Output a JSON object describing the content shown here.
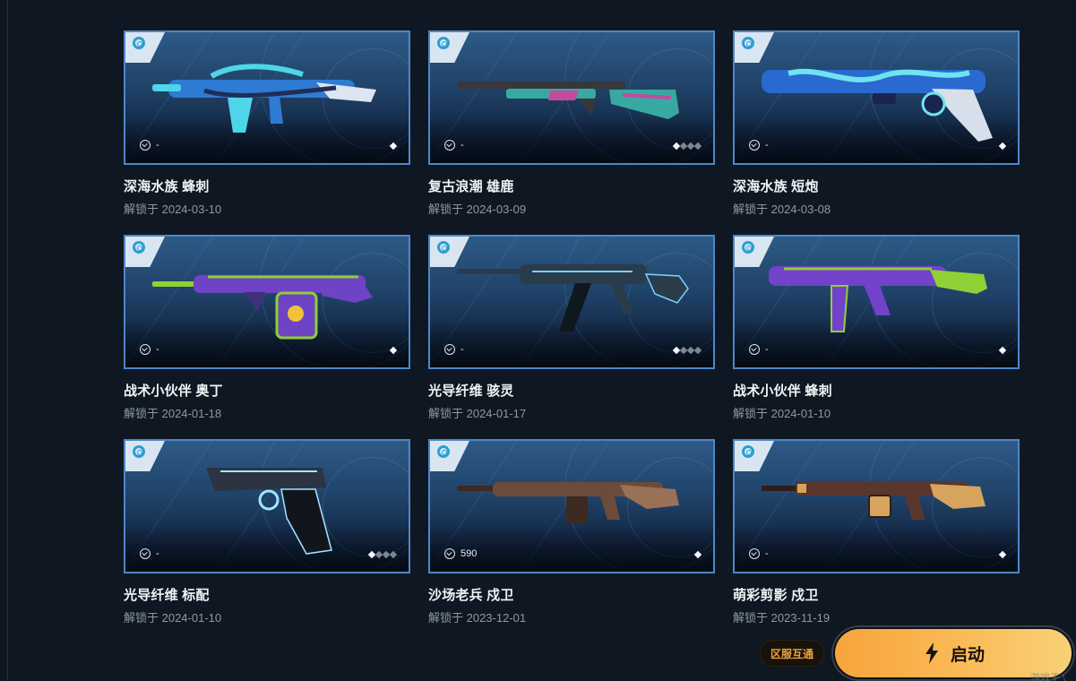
{
  "app_ui": {
    "region_badge": "区服互通",
    "launch_button": "启动",
    "corner_text": "游戏王 \\"
  },
  "items": [
    {
      "name": "深海水族 蜂刺",
      "date": "解锁于 2024-03-10",
      "price": "-",
      "level_on": 1,
      "level_total": 1,
      "icon": "stinger-smg-icon",
      "colors": {
        "primary": "#2e7bd3",
        "accent": "#4fd5ea",
        "dark": "#1f2d57"
      }
    },
    {
      "name": "复古浪潮 雄鹿",
      "date": "解锁于 2024-03-09",
      "price": "-",
      "level_on": 1,
      "level_total": 4,
      "icon": "bucky-shotgun-icon",
      "colors": {
        "primary": "#38a9a1",
        "accent": "#c34b9e",
        "dark": "#37373c"
      }
    },
    {
      "name": "深海水族 短炮",
      "date": "解锁于 2024-03-08",
      "price": "-",
      "level_on": 1,
      "level_total": 1,
      "icon": "shorty-shotgun-icon",
      "colors": {
        "primary": "#2a69cf",
        "accent": "#6fe3f1",
        "dark": "#1b2451"
      }
    },
    {
      "name": "战术小伙伴 奥丁",
      "date": "解锁于 2024-01-18",
      "price": "-",
      "level_on": 1,
      "level_total": 1,
      "icon": "odin-mg-icon",
      "colors": {
        "primary": "#6e43c4",
        "accent": "#90cf35",
        "dark": "#40307a"
      }
    },
    {
      "name": "光导纤维 骇灵",
      "date": "解锁于 2024-01-17",
      "price": "-",
      "level_on": 1,
      "level_total": 4,
      "icon": "spectre-smg-icon",
      "colors": {
        "primary": "#2a3b4b",
        "accent": "#7ad3ff",
        "dark": "#0f171f"
      }
    },
    {
      "name": "战术小伙伴 蜂刺",
      "date": "解锁于 2024-01-10",
      "price": "-",
      "level_on": 1,
      "level_total": 1,
      "icon": "stinger-smg-icon",
      "colors": {
        "primary": "#7342cb",
        "accent": "#8fd037",
        "dark": "#3d2c75"
      }
    },
    {
      "name": "光导纤维 标配",
      "date": "解锁于 2024-01-10",
      "price": "-",
      "level_on": 1,
      "level_total": 4,
      "icon": "classic-pistol-icon",
      "colors": {
        "primary": "#2b3440",
        "accent": "#9fe8ff",
        "dark": "#11161d"
      }
    },
    {
      "name": "沙场老兵 戍卫",
      "date": "解锁于 2023-12-01",
      "price": "590",
      "level_on": 1,
      "level_total": 1,
      "icon": "guardian-rifle-icon",
      "colors": {
        "primary": "#6b4b3a",
        "accent": "#9a7057",
        "dark": "#3d2a20"
      }
    },
    {
      "name": "萌彩剪影 戍卫",
      "date": "解锁于 2023-11-19",
      "price": "-",
      "level_on": 1,
      "level_total": 1,
      "icon": "guardian-rifle-icon",
      "colors": {
        "primary": "#5b362d",
        "accent": "#d6a45d",
        "dark": "#2f1d19"
      }
    }
  ]
}
